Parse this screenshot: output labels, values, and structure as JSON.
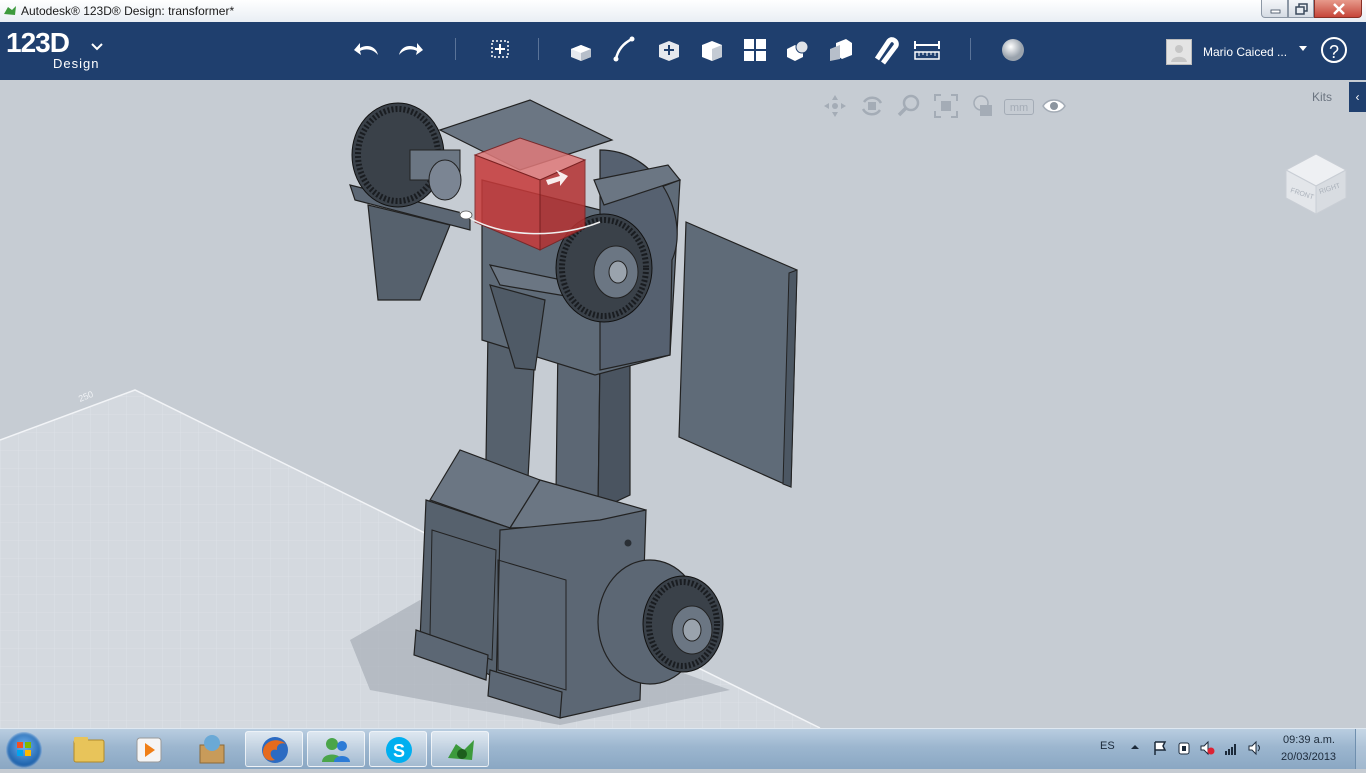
{
  "window": {
    "title": "Autodesk® 123D® Design: transformer*"
  },
  "toolbar": {
    "logo_main": "123D",
    "logo_sub": "Design",
    "logo_menu_icon": "chevron-down-icon",
    "tools": [
      "undo-icon",
      "redo-icon",
      "transform-icon",
      "primitives-icon",
      "sketch-icon",
      "construct-icon",
      "modify-icon",
      "pattern-icon",
      "group-icon",
      "combine-icon",
      "snap-icon",
      "measure-icon",
      "material-icon"
    ],
    "user_name": "Mario Caiced ...",
    "help_label": "?"
  },
  "viewport": {
    "nav_tools": [
      "pan-icon",
      "orbit-icon",
      "zoom-icon",
      "fit-icon",
      "view-mode-icon",
      "units-mm-icon",
      "visibility-icon"
    ],
    "units_label": "mm",
    "kits_label": "Kits",
    "kits_arrow": "‹",
    "viewcube_front": "FRONT",
    "viewcube_right": "RIGHT",
    "grid_label": "250"
  },
  "taskbar": {
    "apps": [
      "windows-explorer-icon",
      "media-player-icon",
      "app-store-icon",
      "firefox-icon",
      "messenger-icon",
      "skype-icon",
      "123d-design-icon"
    ],
    "language": "ES",
    "time": "09:39 a.m.",
    "date": "20/03/2013"
  },
  "colors": {
    "toolbar_bg": "#1f3f6e",
    "viewport_bg": "#c6ccd3",
    "model_gray": "#5f6b78",
    "selection_red": "#c83a3a"
  }
}
